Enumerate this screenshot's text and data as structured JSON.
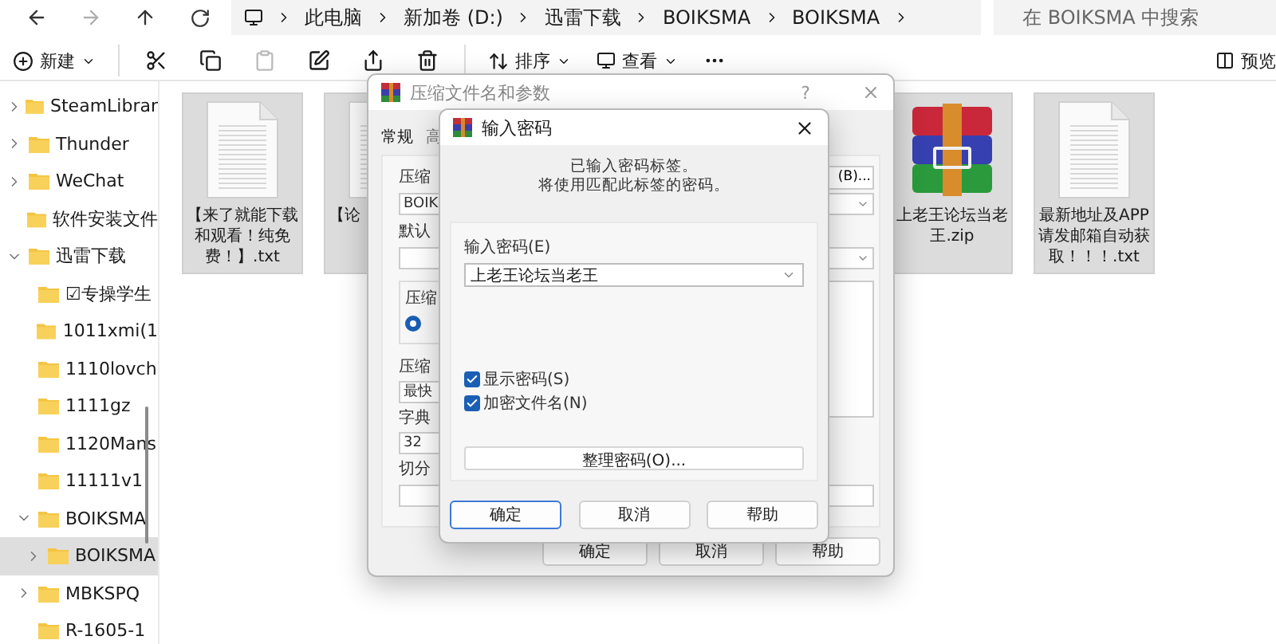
{
  "explorer": {
    "breadcrumb": [
      "此电脑",
      "新加卷 (D:)",
      "迅雷下载",
      "BOIKSMA",
      "BOIKSMA"
    ],
    "search": {
      "placeholder": "在 BOIKSMA 中搜索"
    },
    "toolbar": {
      "new_label": "新建",
      "actions": [
        {
          "kind": "cut",
          "disabled": false
        },
        {
          "kind": "copy",
          "disabled": false
        },
        {
          "kind": "paste",
          "disabled": true
        },
        {
          "kind": "rename",
          "disabled": false
        },
        {
          "kind": "share",
          "disabled": false
        },
        {
          "kind": "delete",
          "disabled": false
        }
      ],
      "sort_label": "排序",
      "view_label": "查看",
      "preview_label": "预览"
    },
    "sidebar": {
      "items": [
        {
          "label": "SteamLibrar",
          "expanded": false
        },
        {
          "label": "Thunder",
          "expanded": false
        },
        {
          "label": "WeChat",
          "expanded": false
        },
        {
          "label": "软件安装文件"
        },
        {
          "label": "迅雷下载",
          "expanded": true,
          "children": [
            {
              "label": "☑专操学生"
            },
            {
              "label": "1011xmi(1"
            },
            {
              "label": "1110lovch"
            },
            {
              "label": "1111gz"
            },
            {
              "label": "1120Mans"
            },
            {
              "label": "11111v1"
            },
            {
              "label": "BOIKSMA",
              "expanded": true,
              "children": [
                {
                  "label": "BOIKSMA",
                  "expanded": false,
                  "selected": true
                }
              ]
            },
            {
              "label": "MBKSPQ",
              "expanded": false
            },
            {
              "label": "R-1605-1"
            }
          ]
        }
      ]
    },
    "files_left": [
      {
        "name": "【来了就能下载和观看！纯免费！】.txt",
        "kind": "text",
        "selected": true,
        "clipped": false
      },
      {
        "name": "【论",
        "kind": "text",
        "selected": true,
        "clipped": true
      }
    ],
    "files_right": [
      {
        "name": "上老王论坛当老王.zip",
        "kind": "archive",
        "selected": true,
        "clipped": false
      },
      {
        "name": "最新地址及APP请发邮箱自动获取！！！.txt",
        "kind": "text",
        "selected": true,
        "clipped": false
      }
    ]
  },
  "archive_dialog": {
    "title": "压缩文件名和参数",
    "help": "?",
    "tabs": [
      {
        "label": "常规",
        "selected": true
      },
      {
        "label": "高",
        "selected": false
      }
    ],
    "archive_label": "压缩",
    "browse_button": "(B)...",
    "archive_name": "BOIK",
    "profile_label": "默认",
    "format_group": "压缩",
    "format_radio": {
      "selected": true
    },
    "method_label": "压缩",
    "method_value": "最快",
    "dict_label": "字典",
    "dict_value": "32",
    "split_label": "切分",
    "buttons": [
      "确定",
      "取消",
      "帮助"
    ]
  },
  "password_dialog": {
    "title": "输入密码",
    "notice": [
      "已输入密码标签。",
      "将使用匹配此标签的密码。"
    ],
    "password_label": "输入密码(E)",
    "password_value": "上老王论坛当老王",
    "options": [
      {
        "label": "显示密码(S)",
        "checked": true
      },
      {
        "label": "加密文件名(N)",
        "checked": true
      }
    ],
    "organize_button": "整理密码(O)...",
    "buttons": [
      {
        "label": "确定",
        "selected": true
      },
      {
        "label": "取消",
        "selected": false
      },
      {
        "label": "帮助",
        "selected": false
      }
    ]
  }
}
